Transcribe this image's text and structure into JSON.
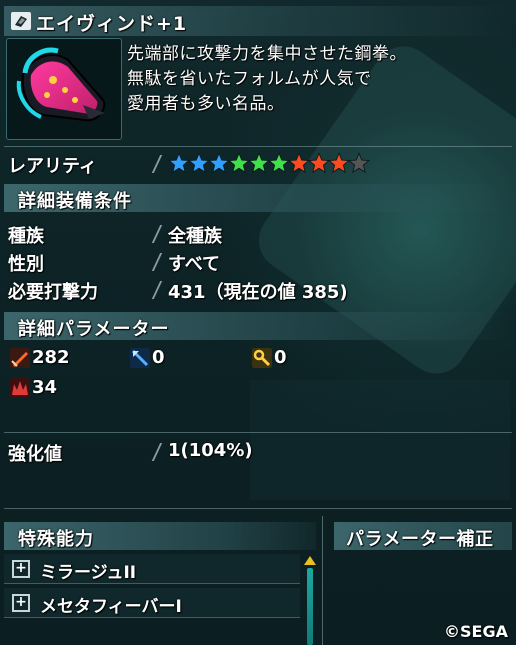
{
  "item": {
    "name": "エイヴィンド+1",
    "icon": "knuckle-weapon-icon",
    "description": [
      "先端部に攻撃力を集中させた鋼拳。",
      "無駄を省いたフォルムが人気で",
      "愛用者も多い名品。"
    ]
  },
  "rarity": {
    "label": "レアリティ",
    "stars": 9,
    "max_stars": 10,
    "star_colors": [
      "#2fa0ff",
      "#2fa0ff",
      "#2fa0ff",
      "#3fe04a",
      "#3fe04a",
      "#3fe04a",
      "#ff4a20",
      "#ff4a20",
      "#ff4a20",
      "#555555"
    ]
  },
  "equip_conditions": {
    "header": "詳細装備条件",
    "rows": [
      {
        "label": "種族",
        "value": "全種族"
      },
      {
        "label": "性別",
        "value": "すべて"
      },
      {
        "label": "必要打撃力",
        "value": "431（現在の値 385)"
      }
    ]
  },
  "parameters": {
    "header": "詳細パラメーター",
    "items": [
      {
        "icon": "striking-attack-icon",
        "color": "#e04a20",
        "value": "282"
      },
      {
        "icon": "ranged-attack-icon",
        "color": "#3a8ad8",
        "value": "0"
      },
      {
        "icon": "technique-attack-icon",
        "color": "#e8c020",
        "value": "0"
      },
      {
        "icon": "striking-defense-icon",
        "color": "#d03030",
        "value": "34"
      }
    ]
  },
  "enhancement": {
    "label": "強化値",
    "value": "1(104%)"
  },
  "special_abilities": {
    "header": "特殊能力",
    "items": [
      {
        "label": "ミラージュII"
      },
      {
        "label": "メセタフィーバーI"
      }
    ]
  },
  "param_bonus": {
    "header": "パラメーター補正"
  },
  "copyright": "©SEGA"
}
